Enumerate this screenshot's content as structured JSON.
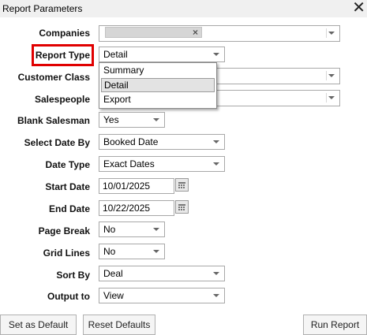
{
  "window": {
    "title": "Report Parameters"
  },
  "icons": {
    "close": "close-icon",
    "calendar": "calendar-icon",
    "remove_tag": "remove-tag-icon"
  },
  "colors": {
    "highlight": "#e00000",
    "titlebar": "#f0f0f0",
    "selected_option": "#e3e3e3"
  },
  "form": {
    "companies": {
      "label": "Companies",
      "tag_remove": "×"
    },
    "report_type": {
      "label": "Report Type",
      "value": "Detail",
      "options": [
        "Summary",
        "Detail",
        "Export"
      ],
      "selected_option": "Detail"
    },
    "customer_class": {
      "label": "Customer Class"
    },
    "salespeople": {
      "label": "Salespeople"
    },
    "blank_salesman": {
      "label": "Blank Salesman",
      "value": "Yes"
    },
    "select_date_by": {
      "label": "Select Date By",
      "value": "Booked Date"
    },
    "date_type": {
      "label": "Date Type",
      "value": "Exact Dates"
    },
    "start_date": {
      "label": "Start Date",
      "value": "10/01/2025"
    },
    "end_date": {
      "label": "End Date",
      "value": "10/22/2025"
    },
    "page_break": {
      "label": "Page Break",
      "value": "No"
    },
    "grid_lines": {
      "label": "Grid Lines",
      "value": "No"
    },
    "sort_by": {
      "label": "Sort By",
      "value": "Deal"
    },
    "output_to": {
      "label": "Output to",
      "value": "View"
    }
  },
  "buttons": {
    "set_default": "Set as Default",
    "reset_defaults": "Reset Defaults",
    "run_report": "Run Report"
  }
}
